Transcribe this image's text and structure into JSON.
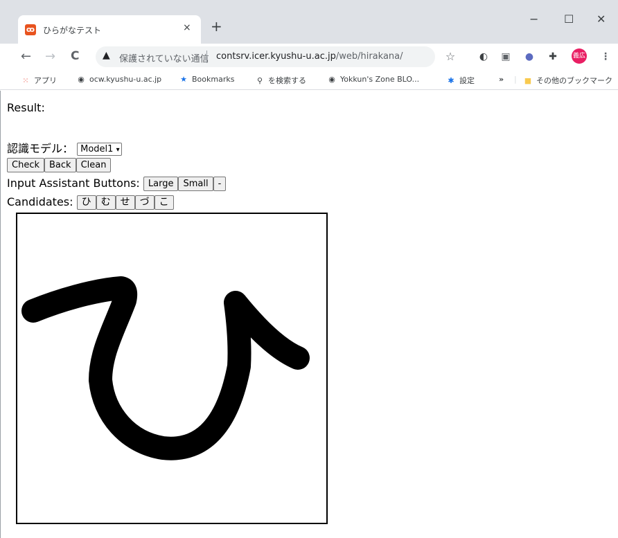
{
  "browser": {
    "tab_title": "ひらがなテスト",
    "tab_close": "×",
    "new_tab": "+",
    "window_controls": {
      "minimize": "−",
      "maximize": "☐",
      "close": "✕"
    },
    "nav": {
      "back": "←",
      "forward": "→",
      "reload": "C"
    },
    "omnibox": {
      "warning_icon": "▲",
      "security_text": "保護されていない通信",
      "url_host": "contsrv.icer.kyushu-u.ac.jp",
      "url_path": "/web/hirakana/"
    },
    "avatar_text": "義広",
    "bookmarks": [
      {
        "label": "アプリ",
        "icon": "apps-grid-icon"
      },
      {
        "label": "ocw.kyushu-u.ac.jp",
        "icon": "globe-icon"
      },
      {
        "label": "Bookmarks",
        "icon": "star-icon"
      },
      {
        "label": "を検索する",
        "icon": "search-icon"
      },
      {
        "label": "Yokkun's Zone BLO...",
        "icon": "globe-icon"
      },
      {
        "label": "設定",
        "icon": "gear-icon"
      }
    ],
    "bookmarks_overflow": "»",
    "other_bookmarks": "その他のブックマーク"
  },
  "page": {
    "result_label": "Result:",
    "model_label": "認識モデル：",
    "model_selected": "Model1",
    "buttons": {
      "check": "Check",
      "back": "Back",
      "clean": "Clean"
    },
    "assistant_label": "Input Assistant Buttons:",
    "assistant_buttons": {
      "large": "Large",
      "small": "Small",
      "minus": "-"
    },
    "candidates_label": "Candidates:",
    "candidates": [
      "ひ",
      "む",
      "せ",
      "づ",
      "こ"
    ]
  },
  "colors": {
    "chrome_bg": "#dee1e6",
    "avatar": "#e91e63",
    "favicon": "#e8531f",
    "stroke": "#000000"
  }
}
